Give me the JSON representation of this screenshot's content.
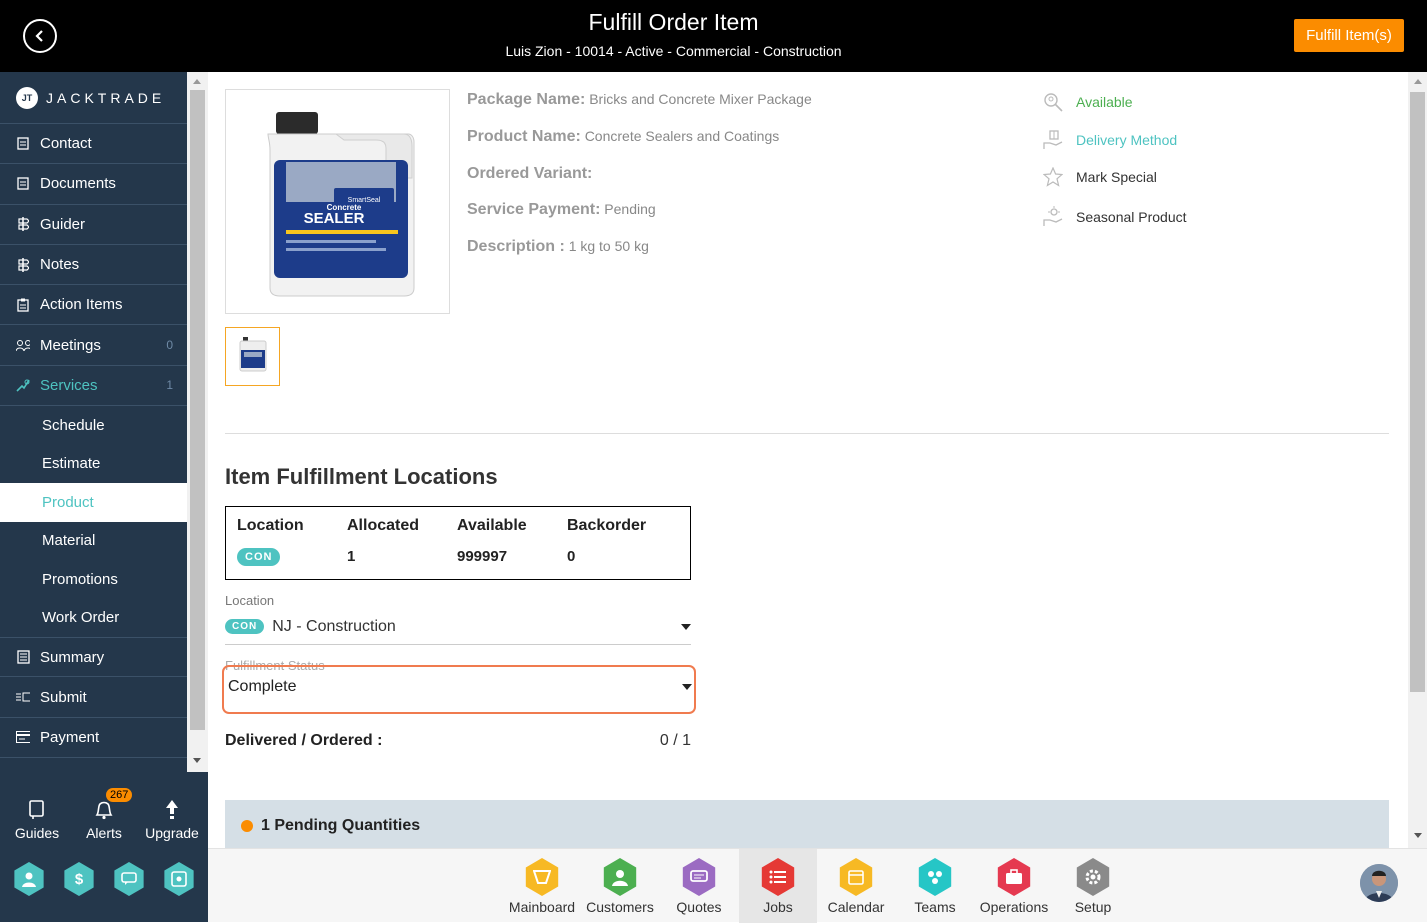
{
  "header": {
    "title": "Fulfill Order Item",
    "subtitle": "Luis Zion - 10014 - Active - Commercial - Construction",
    "fulfill_button": "Fulfill Item(s)"
  },
  "brand": {
    "logo_text": "JACKTRADE",
    "logo_mark": "JT"
  },
  "sidebar": {
    "items": [
      {
        "label": "Contact",
        "icon": "contact-icon"
      },
      {
        "label": "Documents",
        "icon": "documents-icon"
      },
      {
        "label": "Guider",
        "icon": "guider-icon"
      },
      {
        "label": "Notes",
        "icon": "notes-icon"
      },
      {
        "label": "Action Items",
        "icon": "clipboard-icon"
      },
      {
        "label": "Meetings",
        "icon": "meetings-icon",
        "count": "0"
      },
      {
        "label": "Services",
        "icon": "services-icon",
        "count": "1"
      }
    ],
    "sub_items": [
      "Schedule",
      "Estimate",
      "Product",
      "Material",
      "Promotions",
      "Work Order"
    ],
    "selected_sub": "Product",
    "items2": [
      {
        "label": "Summary",
        "icon": "summary-icon"
      },
      {
        "label": "Submit",
        "icon": "submit-icon"
      },
      {
        "label": "Payment",
        "icon": "payment-icon"
      }
    ]
  },
  "bottom_left": {
    "guides": "Guides",
    "alerts": "Alerts",
    "alerts_count": "267",
    "upgrade": "Upgrade"
  },
  "product": {
    "package_label": "Package Name:",
    "package_value": "Bricks and Concrete Mixer Package",
    "product_label": "Product Name:",
    "product_value": "Concrete Sealers and Coatings",
    "variant_label": "Ordered Variant:",
    "payment_label": "Service Payment:",
    "payment_value": "Pending",
    "description_label": "Description :",
    "description_value": "1 kg to 50 kg",
    "image_brand": "SmartSeal",
    "image_line1": "Concrete",
    "image_line2": "SEALER"
  },
  "side_actions": {
    "available": "Available",
    "delivery": "Delivery Method",
    "mark_special": "Mark Special",
    "seasonal": "Seasonal Product"
  },
  "locations": {
    "heading": "Item Fulfillment Locations",
    "columns": [
      "Location",
      "Allocated",
      "Available",
      "Backorder"
    ],
    "row": {
      "chip": "CON",
      "allocated": "1",
      "available": "999997",
      "backorder": "0"
    },
    "location_label": "Location",
    "location_chip": "CON",
    "location_value": "NJ - Construction",
    "status_label": "Fulfillment Status",
    "status_value": "Complete",
    "delivered_label": "Delivered / Ordered :",
    "delivered_value": "0 / 1",
    "pending_text": "1 Pending Quantities"
  },
  "bottom_nav": [
    "Mainboard",
    "Customers",
    "Quotes",
    "Jobs",
    "Calendar",
    "Teams",
    "Operations",
    "Setup"
  ],
  "colors": {
    "accent": "#4ec3c1",
    "orange": "#fb8c00",
    "sidebar": "#24374b",
    "highlight": "#f07b4f"
  }
}
